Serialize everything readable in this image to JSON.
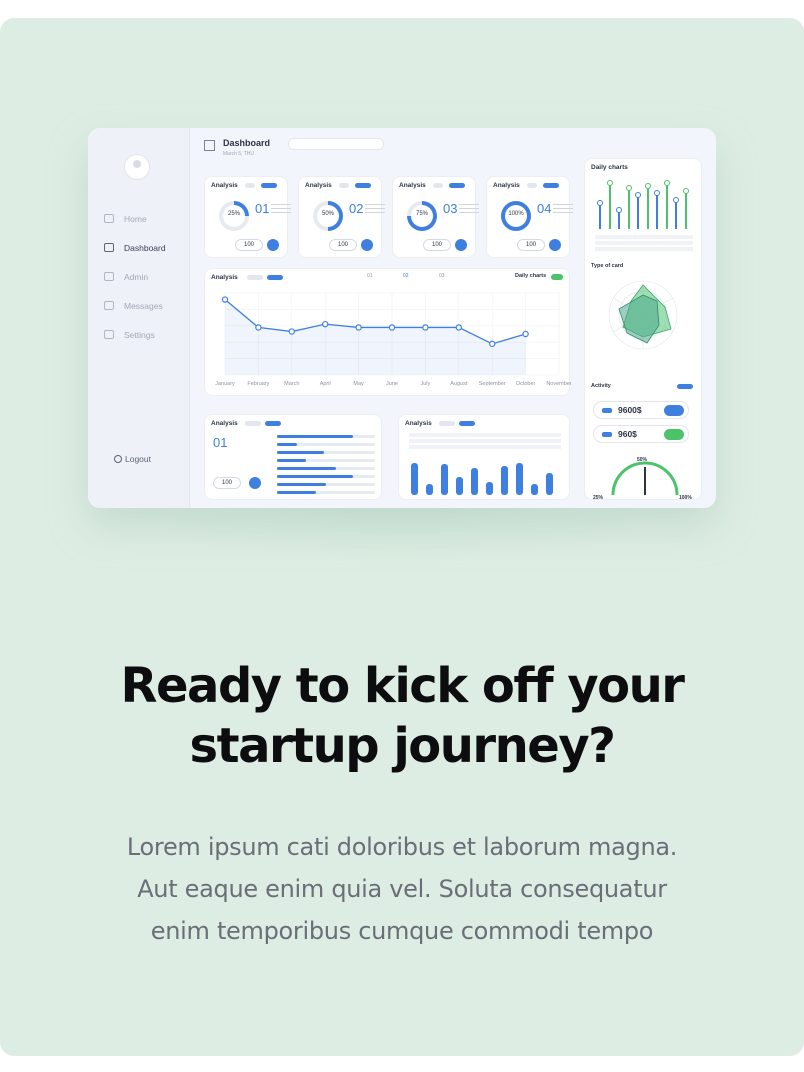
{
  "dashboard": {
    "header": {
      "title": "Dashboard",
      "date": "March 5, THU"
    },
    "sidebar": {
      "items": [
        {
          "label": "Home",
          "icon": "home-icon",
          "active": false
        },
        {
          "label": "Dashboard",
          "icon": "dashboard-icon",
          "active": true
        },
        {
          "label": "Admin",
          "icon": "user-icon",
          "active": false
        },
        {
          "label": "Messages",
          "icon": "message-icon",
          "active": false
        },
        {
          "label": "Settings",
          "icon": "gear-icon",
          "active": false
        }
      ],
      "logout": "Logout"
    },
    "cards": [
      {
        "title": "Analysis",
        "percent": "25%",
        "fraction": 0.25,
        "number": "01",
        "button": "100"
      },
      {
        "title": "Analysis",
        "percent": "50%",
        "fraction": 0.5,
        "number": "02",
        "button": "100"
      },
      {
        "title": "Analysis",
        "percent": "75%",
        "fraction": 0.75,
        "number": "03",
        "button": "100"
      },
      {
        "title": "Analysis",
        "percent": "100%",
        "fraction": 1.0,
        "number": "04",
        "button": "100"
      }
    ],
    "line_panel": {
      "title": "Analysis",
      "toggle_label": "Daily charts",
      "legend": [
        "01",
        "02",
        "03"
      ]
    },
    "bottom_left": {
      "title": "Analysis",
      "number": "01",
      "button": "100",
      "bar_levels": [
        0.78,
        0.2,
        0.48,
        0.3,
        0.6,
        0.78,
        0.5,
        0.4
      ]
    },
    "bottom_mid": {
      "title": "Analysis",
      "bar_levels": [
        0.9,
        0.3,
        0.85,
        0.5,
        0.75,
        0.35,
        0.8,
        0.9,
        0.3,
        0.6
      ]
    },
    "right": {
      "daily_title": "Daily charts",
      "radar_title": "Type of card",
      "activity_title": "Activity",
      "stats": [
        {
          "value": "9600$",
          "toggle_color": "#3e7fe0"
        },
        {
          "value": "960$",
          "toggle_color": "#4cc26a"
        }
      ],
      "gauge": {
        "min_label": "25%",
        "mid_label": "50%",
        "max_label": "100%",
        "fraction": 0.5
      },
      "daily_bar_levels": [
        0.55,
        0.95,
        0.4,
        0.85,
        0.7,
        0.9,
        0.75,
        0.95,
        0.6,
        0.8
      ]
    }
  },
  "chart_data": {
    "type": "line",
    "categories": [
      "January",
      "February",
      "March",
      "April",
      "May",
      "June",
      "July",
      "August",
      "September",
      "October",
      "November"
    ],
    "series": [
      {
        "values": [
          92,
          58,
          53,
          62,
          58,
          58,
          58,
          58,
          38,
          50
        ]
      }
    ],
    "ylim": [
      0,
      100
    ]
  },
  "headline": {
    "line1": "Ready to kick off your",
    "line2": "startup journey?"
  },
  "paragraph": {
    "line1": "Lorem ipsum cati doloribus et laborum magna.",
    "line2": "Aut eaque enim quia vel. Soluta consequatur",
    "line3": "enim temporibus cumque commodi tempo"
  },
  "colors": {
    "background": "#deede3",
    "accent": "#3e7fe0",
    "green": "#4cc26a",
    "heading": "#0d0d0f",
    "body_text": "#6a6e78"
  }
}
